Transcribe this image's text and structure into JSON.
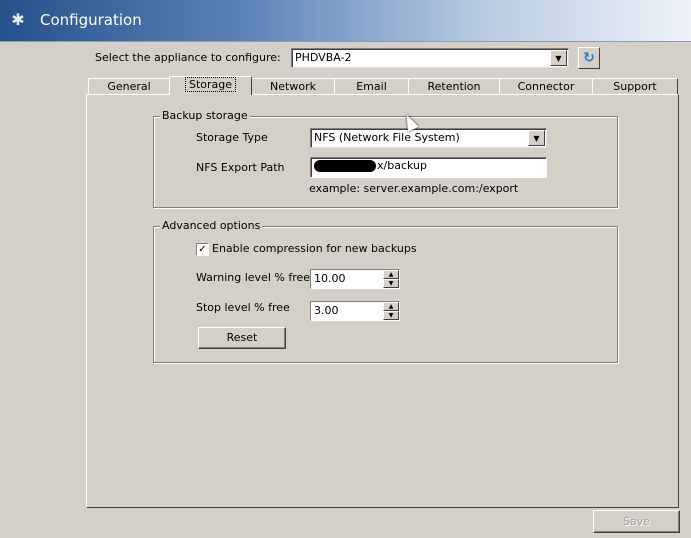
{
  "window": {
    "title": "Configuration",
    "icon": "gear-icon"
  },
  "appliance": {
    "label": "Select the appliance to configure:",
    "selected": "PHDVBA-2"
  },
  "tabs": [
    {
      "label": "General"
    },
    {
      "label": "Storage",
      "active": true
    },
    {
      "label": "Network"
    },
    {
      "label": "Email"
    },
    {
      "label": "Retention"
    },
    {
      "label": "Connector"
    },
    {
      "label": "Support"
    }
  ],
  "backup_storage": {
    "title": "Backup storage",
    "storage_type_label": "Storage Type",
    "storage_type_value": "NFS (Network File System)",
    "nfs_path_label": "NFS Export Path",
    "nfs_path_value": "x/backup",
    "example": "example: server.example.com:/export"
  },
  "advanced": {
    "title": "Advanced options",
    "compression_label": "Enable compression for new backups",
    "compression_checked": true,
    "warning_label": "Warning level % free",
    "warning_value": "10.00",
    "stop_label": "Stop level % free",
    "stop_value": "3.00",
    "reset_label": "Reset"
  },
  "footer": {
    "save_label": "Save"
  }
}
